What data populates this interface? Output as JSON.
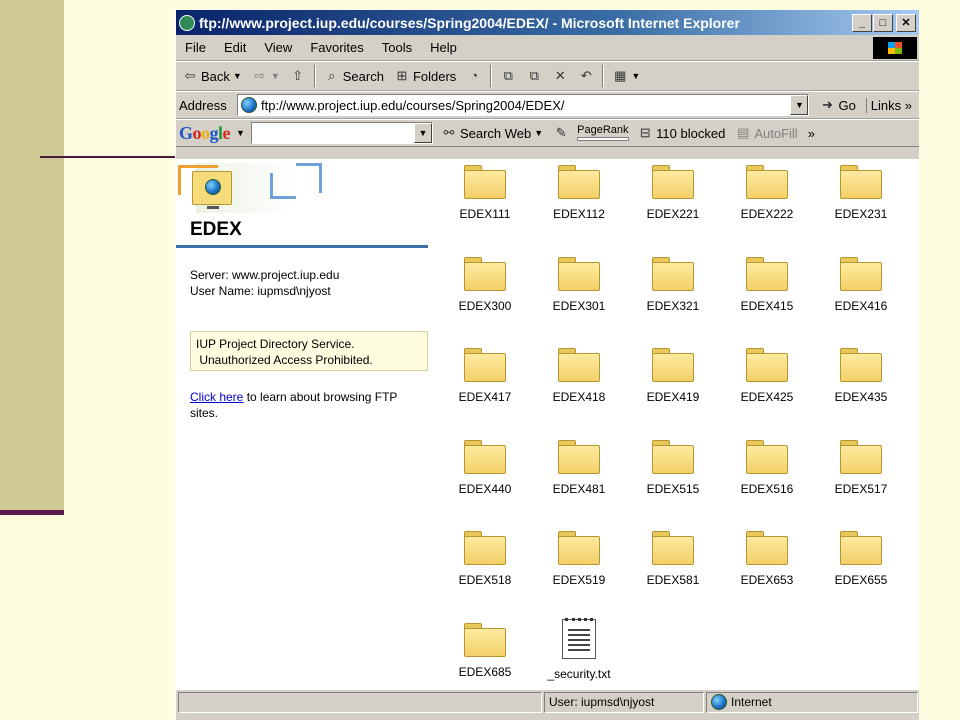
{
  "window": {
    "title": "ftp://www.project.iup.edu/courses/Spring2004/EDEX/ - Microsoft Internet Explorer",
    "controls": {
      "minimize": "_",
      "maximize": "□",
      "close": "✕"
    }
  },
  "menu": [
    "File",
    "Edit",
    "View",
    "Favorites",
    "Tools",
    "Help"
  ],
  "toolbar": {
    "back": "Back",
    "search": "Search",
    "folders": "Folders"
  },
  "address": {
    "label": "Address",
    "url": "ftp://www.project.iup.edu/courses/Spring2004/EDEX/",
    "go": "Go",
    "links": "Links"
  },
  "google_bar": {
    "logo": [
      "G",
      "o",
      "o",
      "g",
      "l",
      "e"
    ],
    "search_web": "Search Web",
    "pagerank": "PageRank",
    "blocked": "110 blocked",
    "autofill": "AutoFill"
  },
  "panel": {
    "title": "EDEX",
    "server_line": "Server: www.project.iup.edu",
    "user_line": "User Name: iupmsd\\njyost",
    "notice_line1": "IUP Project Directory Service.",
    "notice_line2": " Unauthorized Access Prohibited.",
    "help_link": "Click here",
    "help_rest": " to learn about browsing FTP sites."
  },
  "files": [
    {
      "name": "EDEX111",
      "type": "folder"
    },
    {
      "name": "EDEX112",
      "type": "folder"
    },
    {
      "name": "EDEX221",
      "type": "folder"
    },
    {
      "name": "EDEX222",
      "type": "folder"
    },
    {
      "name": "EDEX231",
      "type": "folder"
    },
    {
      "name": "EDEX300",
      "type": "folder"
    },
    {
      "name": "EDEX301",
      "type": "folder"
    },
    {
      "name": "EDEX321",
      "type": "folder"
    },
    {
      "name": "EDEX415",
      "type": "folder"
    },
    {
      "name": "EDEX416",
      "type": "folder"
    },
    {
      "name": "EDEX417",
      "type": "folder"
    },
    {
      "name": "EDEX418",
      "type": "folder"
    },
    {
      "name": "EDEX419",
      "type": "folder"
    },
    {
      "name": "EDEX425",
      "type": "folder"
    },
    {
      "name": "EDEX435",
      "type": "folder"
    },
    {
      "name": "EDEX440",
      "type": "folder"
    },
    {
      "name": "EDEX481",
      "type": "folder"
    },
    {
      "name": "EDEX515",
      "type": "folder"
    },
    {
      "name": "EDEX516",
      "type": "folder"
    },
    {
      "name": "EDEX517",
      "type": "folder"
    },
    {
      "name": "EDEX518",
      "type": "folder"
    },
    {
      "name": "EDEX519",
      "type": "folder"
    },
    {
      "name": "EDEX581",
      "type": "folder"
    },
    {
      "name": "EDEX653",
      "type": "folder"
    },
    {
      "name": "EDEX655",
      "type": "folder"
    },
    {
      "name": "EDEX685",
      "type": "folder"
    },
    {
      "name": "_security.txt",
      "type": "text-file"
    }
  ],
  "status": {
    "user": "User: iupmsd\\njyost",
    "zone": "Internet"
  },
  "colors": {
    "slide_background": "#FFFDE0",
    "slide_sidebar": "#CDC894",
    "slide_accent": "#5A1A4A",
    "titlebar": "#0A246A",
    "chrome": "#D4D0C8",
    "folder": "#F3D068",
    "link": "#0000CC"
  }
}
